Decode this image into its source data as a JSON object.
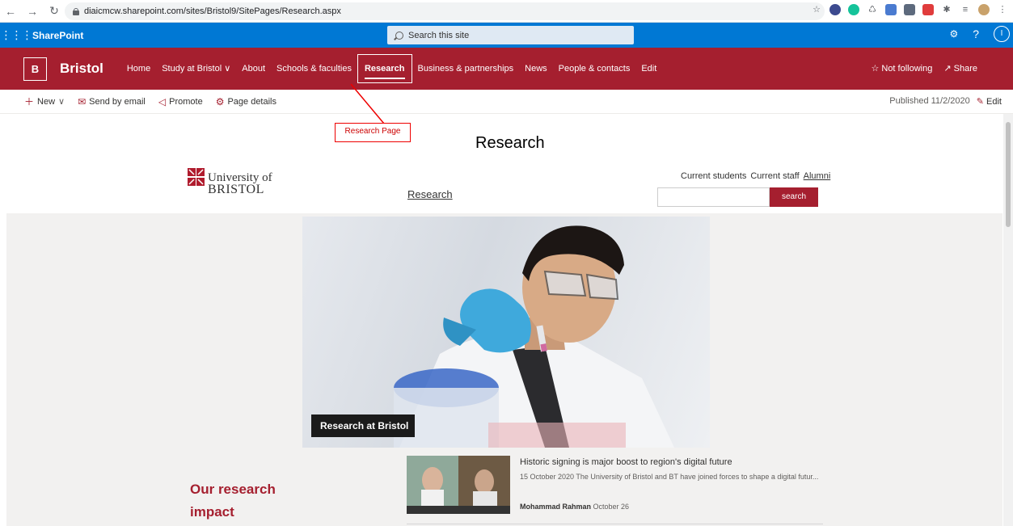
{
  "browser": {
    "url": "diaicmcw.sharepoint.com/sites/Bristol9/SitePages/Research.aspx",
    "nav_icons": [
      "back-icon",
      "forward-icon",
      "reload-icon"
    ]
  },
  "suite": {
    "brand": "SharePoint",
    "search_placeholder": "Search this site",
    "help": "?",
    "avatar": "I"
  },
  "site": {
    "logo_letter": "B",
    "title": "Bristol",
    "nav": [
      "Home",
      "Study at Bristol",
      "About",
      "Schools & faculties",
      "Research",
      "Business & partnerships",
      "News",
      "People & contacts",
      "Edit"
    ],
    "active_nav": "Research",
    "follow": "Not following",
    "share": "Share"
  },
  "command_bar": {
    "new": "New",
    "send": "Send by email",
    "promote": "Promote",
    "details": "Page details",
    "published": "Published 11/2/2020",
    "edit": "Edit"
  },
  "annotation": {
    "label": "Research Page",
    "color": "#e00000"
  },
  "page": {
    "title": "Research",
    "logo_line1": "University of",
    "logo_line2": "BRISTOL",
    "research_link": "Research",
    "links": {
      "current_students": "Current students",
      "current_staff": "Current staff",
      "alumni": "Alumni"
    },
    "search_button": "search",
    "hero_caption": "Research at Bristol",
    "impact_heading": "Our research impact"
  },
  "news": {
    "title": "Historic signing is major boost to region's digital future",
    "description": "15 October 2020 The University of Bristol and BT have joined forces to shape a digital futur...",
    "author": "Mohammad Rahman",
    "date": "October 26"
  },
  "colors": {
    "suite_blue": "#0078d4",
    "bristol_red": "#a51f2f"
  }
}
